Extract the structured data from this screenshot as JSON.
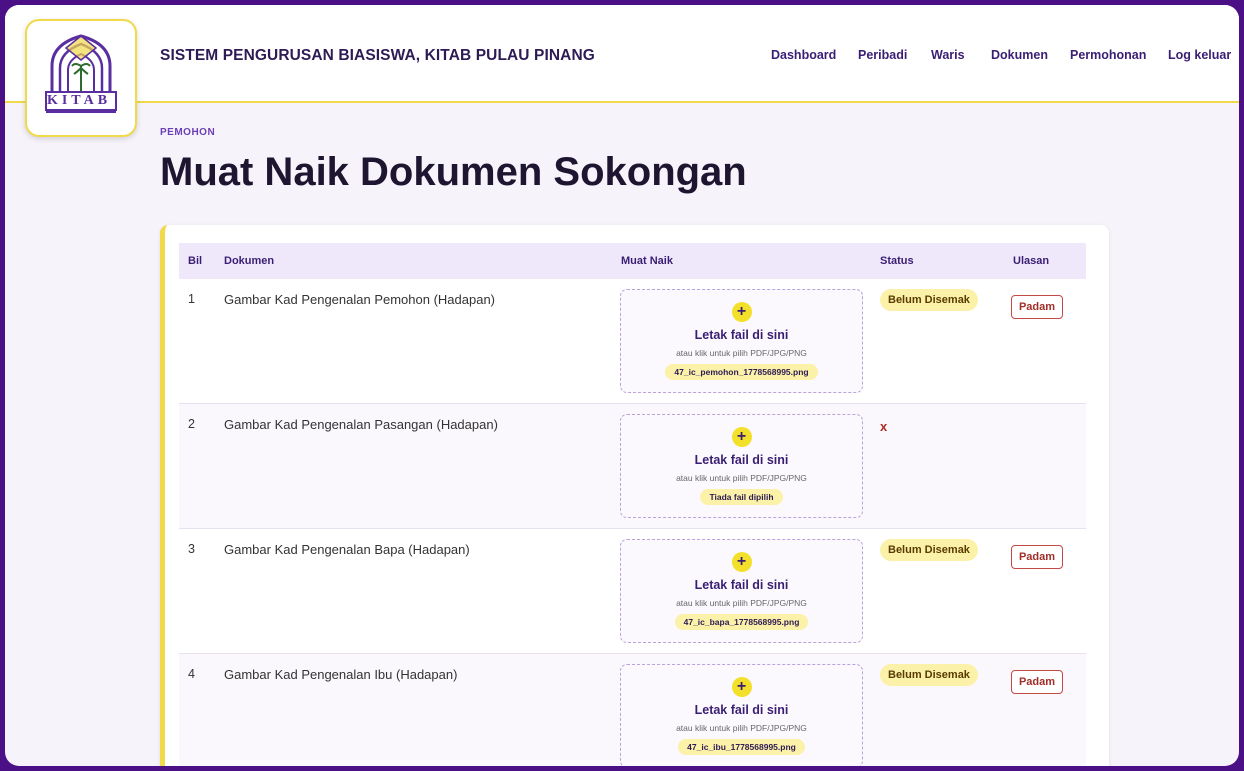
{
  "app": {
    "title": "SISTEM PENGURUSAN BIASISWA, KITAB PULAU PINANG",
    "logo_text": "KITAB"
  },
  "nav": [
    {
      "label": "Dashboard"
    },
    {
      "label": "Peribadi"
    },
    {
      "label": "Waris"
    },
    {
      "label": "Dokumen"
    },
    {
      "label": "Permohonan"
    },
    {
      "label": "Log keluar"
    }
  ],
  "page": {
    "kicker": "PEMOHON",
    "title": "Muat Naik Dokumen Sokongan"
  },
  "table": {
    "headers": {
      "bil": "Bil",
      "dokumen": "Dokumen",
      "muat_naik": "Muat Naik",
      "status": "Status",
      "ulasan": "Ulasan"
    },
    "rows": [
      {
        "bil": "1",
        "dokumen": "Gambar Kad Pengenalan Pemohon (Hadapan)",
        "drop_title": "Letak fail di sini",
        "drop_sub": "atau klik untuk pilih PDF/JPG/PNG",
        "file": "47_ic_pemohon_1778568995.png",
        "status": "Belum Disemak",
        "action": "Padam"
      },
      {
        "bil": "2",
        "dokumen": "Gambar Kad Pengenalan Pasangan (Hadapan)",
        "drop_title": "Letak fail di sini",
        "drop_sub": "atau klik untuk pilih PDF/JPG/PNG",
        "file": "Tiada fail dipilih",
        "status": "x",
        "action": ""
      },
      {
        "bil": "3",
        "dokumen": "Gambar Kad Pengenalan Bapa (Hadapan)",
        "drop_title": "Letak fail di sini",
        "drop_sub": "atau klik untuk pilih PDF/JPG/PNG",
        "file": "47_ic_bapa_1778568995.png",
        "status": "Belum Disemak",
        "action": "Padam"
      },
      {
        "bil": "4",
        "dokumen": "Gambar Kad Pengenalan Ibu (Hadapan)",
        "drop_title": "Letak fail di sini",
        "drop_sub": "atau klik untuk pilih PDF/JPG/PNG",
        "file": "47_ic_ibu_1778568995.png",
        "status": "Belum Disemak",
        "action": "Padam"
      }
    ]
  },
  "colors": {
    "accent_yellow": "#f0d94a",
    "brand_purple": "#4b0f86",
    "danger_red": "#b02a22"
  }
}
